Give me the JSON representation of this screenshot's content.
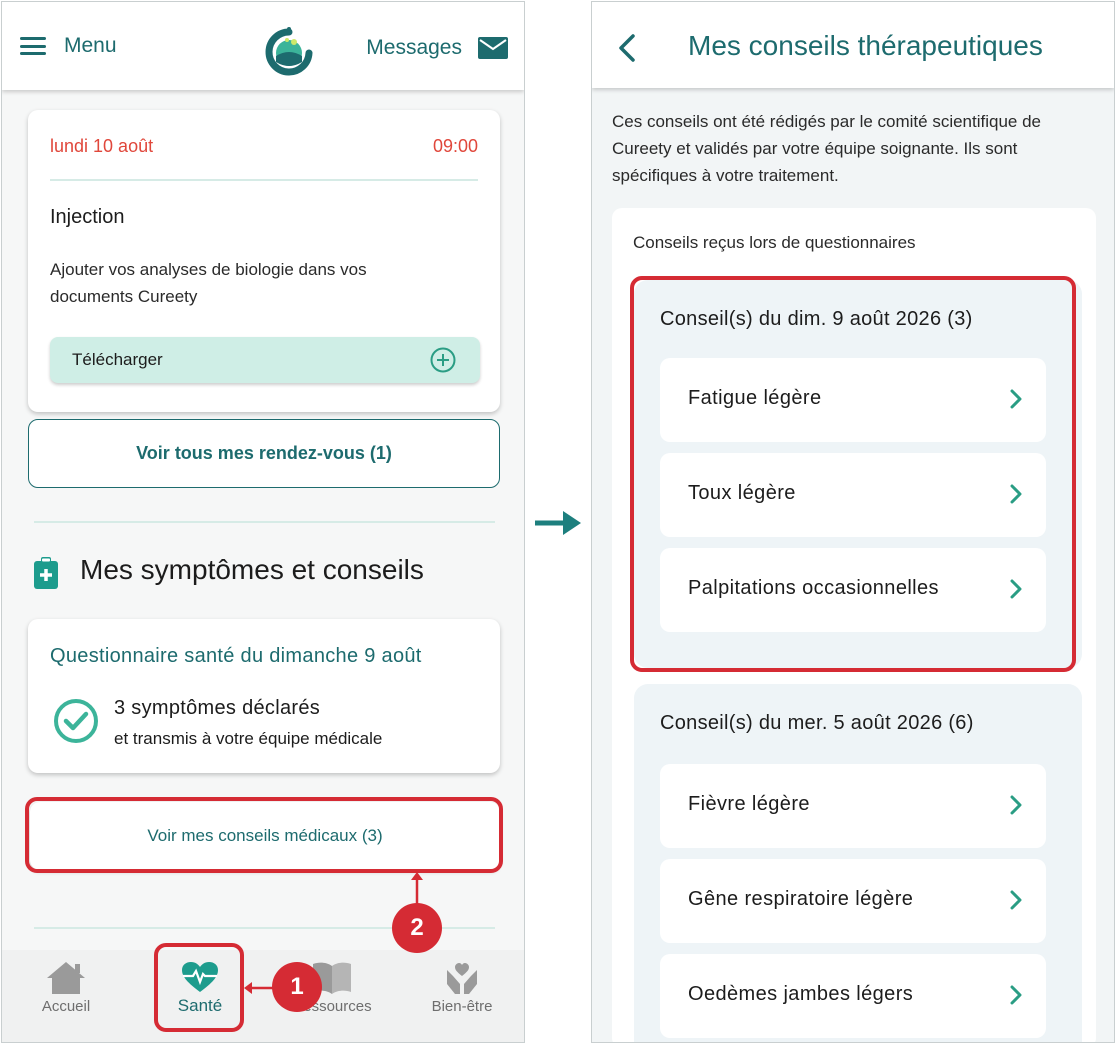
{
  "left": {
    "topbar": {
      "menu_label": "Menu",
      "messages_label": "Messages"
    },
    "appointment": {
      "date": "lundi 10 août",
      "time": "09:00",
      "title": "Injection",
      "description": "Ajouter vos analyses de biologie dans vos documents Cureety",
      "download_label": "Télécharger"
    },
    "see_appointments_label": "Voir tous mes rendez-vous (1)",
    "section_title": "Mes symptômes et conseils",
    "questionnaire": {
      "title": "Questionnaire santé du dimanche 9 août",
      "count": "3 symptômes déclarés",
      "subtitle": "et transmis à votre équipe médicale"
    },
    "advice_button_label": "Voir mes conseils médicaux (3)",
    "nav": [
      {
        "label": "Accueil",
        "icon": "home-icon"
      },
      {
        "label": "Santé",
        "icon": "heart-pulse-icon"
      },
      {
        "label": "Ressources",
        "icon": "book-icon"
      },
      {
        "label": "Bien-être",
        "icon": "hands-heart-icon"
      }
    ],
    "badges": {
      "one": "1",
      "two": "2"
    }
  },
  "right": {
    "title": "Mes conseils thérapeutiques",
    "intro": "Ces conseils ont été rédigés par le comité scientifique de Cureety et validés par votre équipe soignante. Ils sont spécifiques à votre traitement.",
    "panel_title": "Conseils reçus lors de questionnaires",
    "groups": [
      {
        "title": "Conseil(s) du dim. 9 août 2026 (3)",
        "items": [
          "Fatigue légère",
          "Toux légère",
          "Palpitations occasionnelles"
        ]
      },
      {
        "title": "Conseil(s) du mer. 5 août 2026 (6)",
        "items": [
          "Fièvre légère",
          "Gêne respiratoire légère",
          "Oedèmes jambes légers"
        ]
      }
    ]
  },
  "colors": {
    "primary": "#1d6b6e",
    "accent_red": "#d52b34",
    "date_red": "#e0473b",
    "mint": "#cfeee6",
    "check_green": "#3cb49a"
  }
}
